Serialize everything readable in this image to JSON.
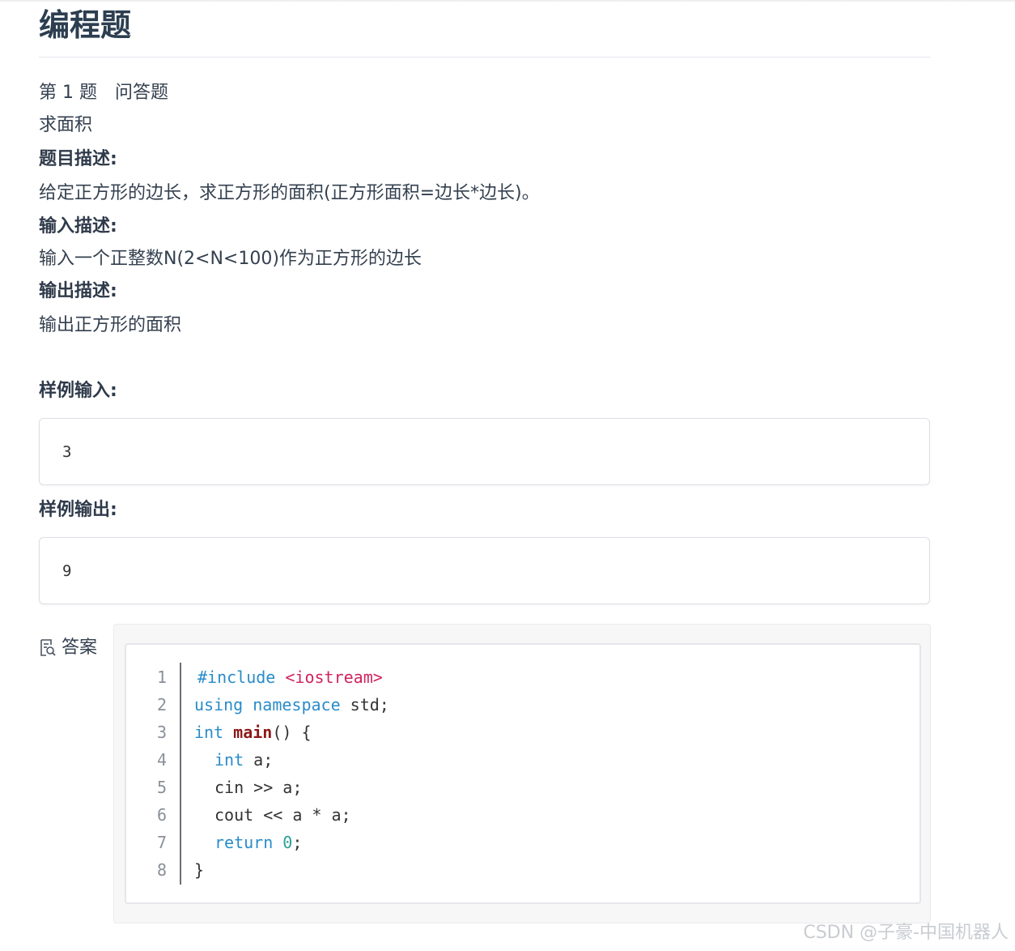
{
  "page": {
    "title": "编程题"
  },
  "question": {
    "number_label": "第 1 题",
    "type_label": "问答题",
    "name": "求面积",
    "desc_heading": "题目描述:",
    "desc_text": "给定正方形的边长，求正方形的面积(正方形面积=边长*边长)。",
    "input_heading": "输入描述:",
    "input_text": "输入一个正整数N(2<N<100)作为正方形的边长",
    "output_heading": "输出描述:",
    "output_text": "输出正方形的面积"
  },
  "samples": {
    "input_heading": "样例输入:",
    "input_value": "3",
    "output_heading": "样例输出:",
    "output_value": "9"
  },
  "answer": {
    "label": "答案",
    "icon": "answer-doc-icon",
    "line_numbers": [
      "1",
      "2",
      "3",
      "4",
      "5",
      "6",
      "7",
      "8"
    ],
    "code": {
      "l1_directive": "#include",
      "l1_header": "<iostream>",
      "l2_kw1": "using",
      "l2_kw2": "namespace",
      "l2_rest": " std;",
      "l3_kw": "int",
      "l3_fn": "main",
      "l3_rest": "() {",
      "l4_kw": "int",
      "l4_rest": " a;",
      "l5": "cin >> a;",
      "l6": "cout << a * a;",
      "l7_kw": "return",
      "l7_num": "0",
      "l7_rest": ";",
      "l8": "}"
    }
  },
  "watermark": "CSDN @子豪-中国机器人",
  "colors": {
    "keyword": "#2a8cc9",
    "string": "#d0245e",
    "function": "#8b1a1a",
    "number": "#2aa198"
  }
}
